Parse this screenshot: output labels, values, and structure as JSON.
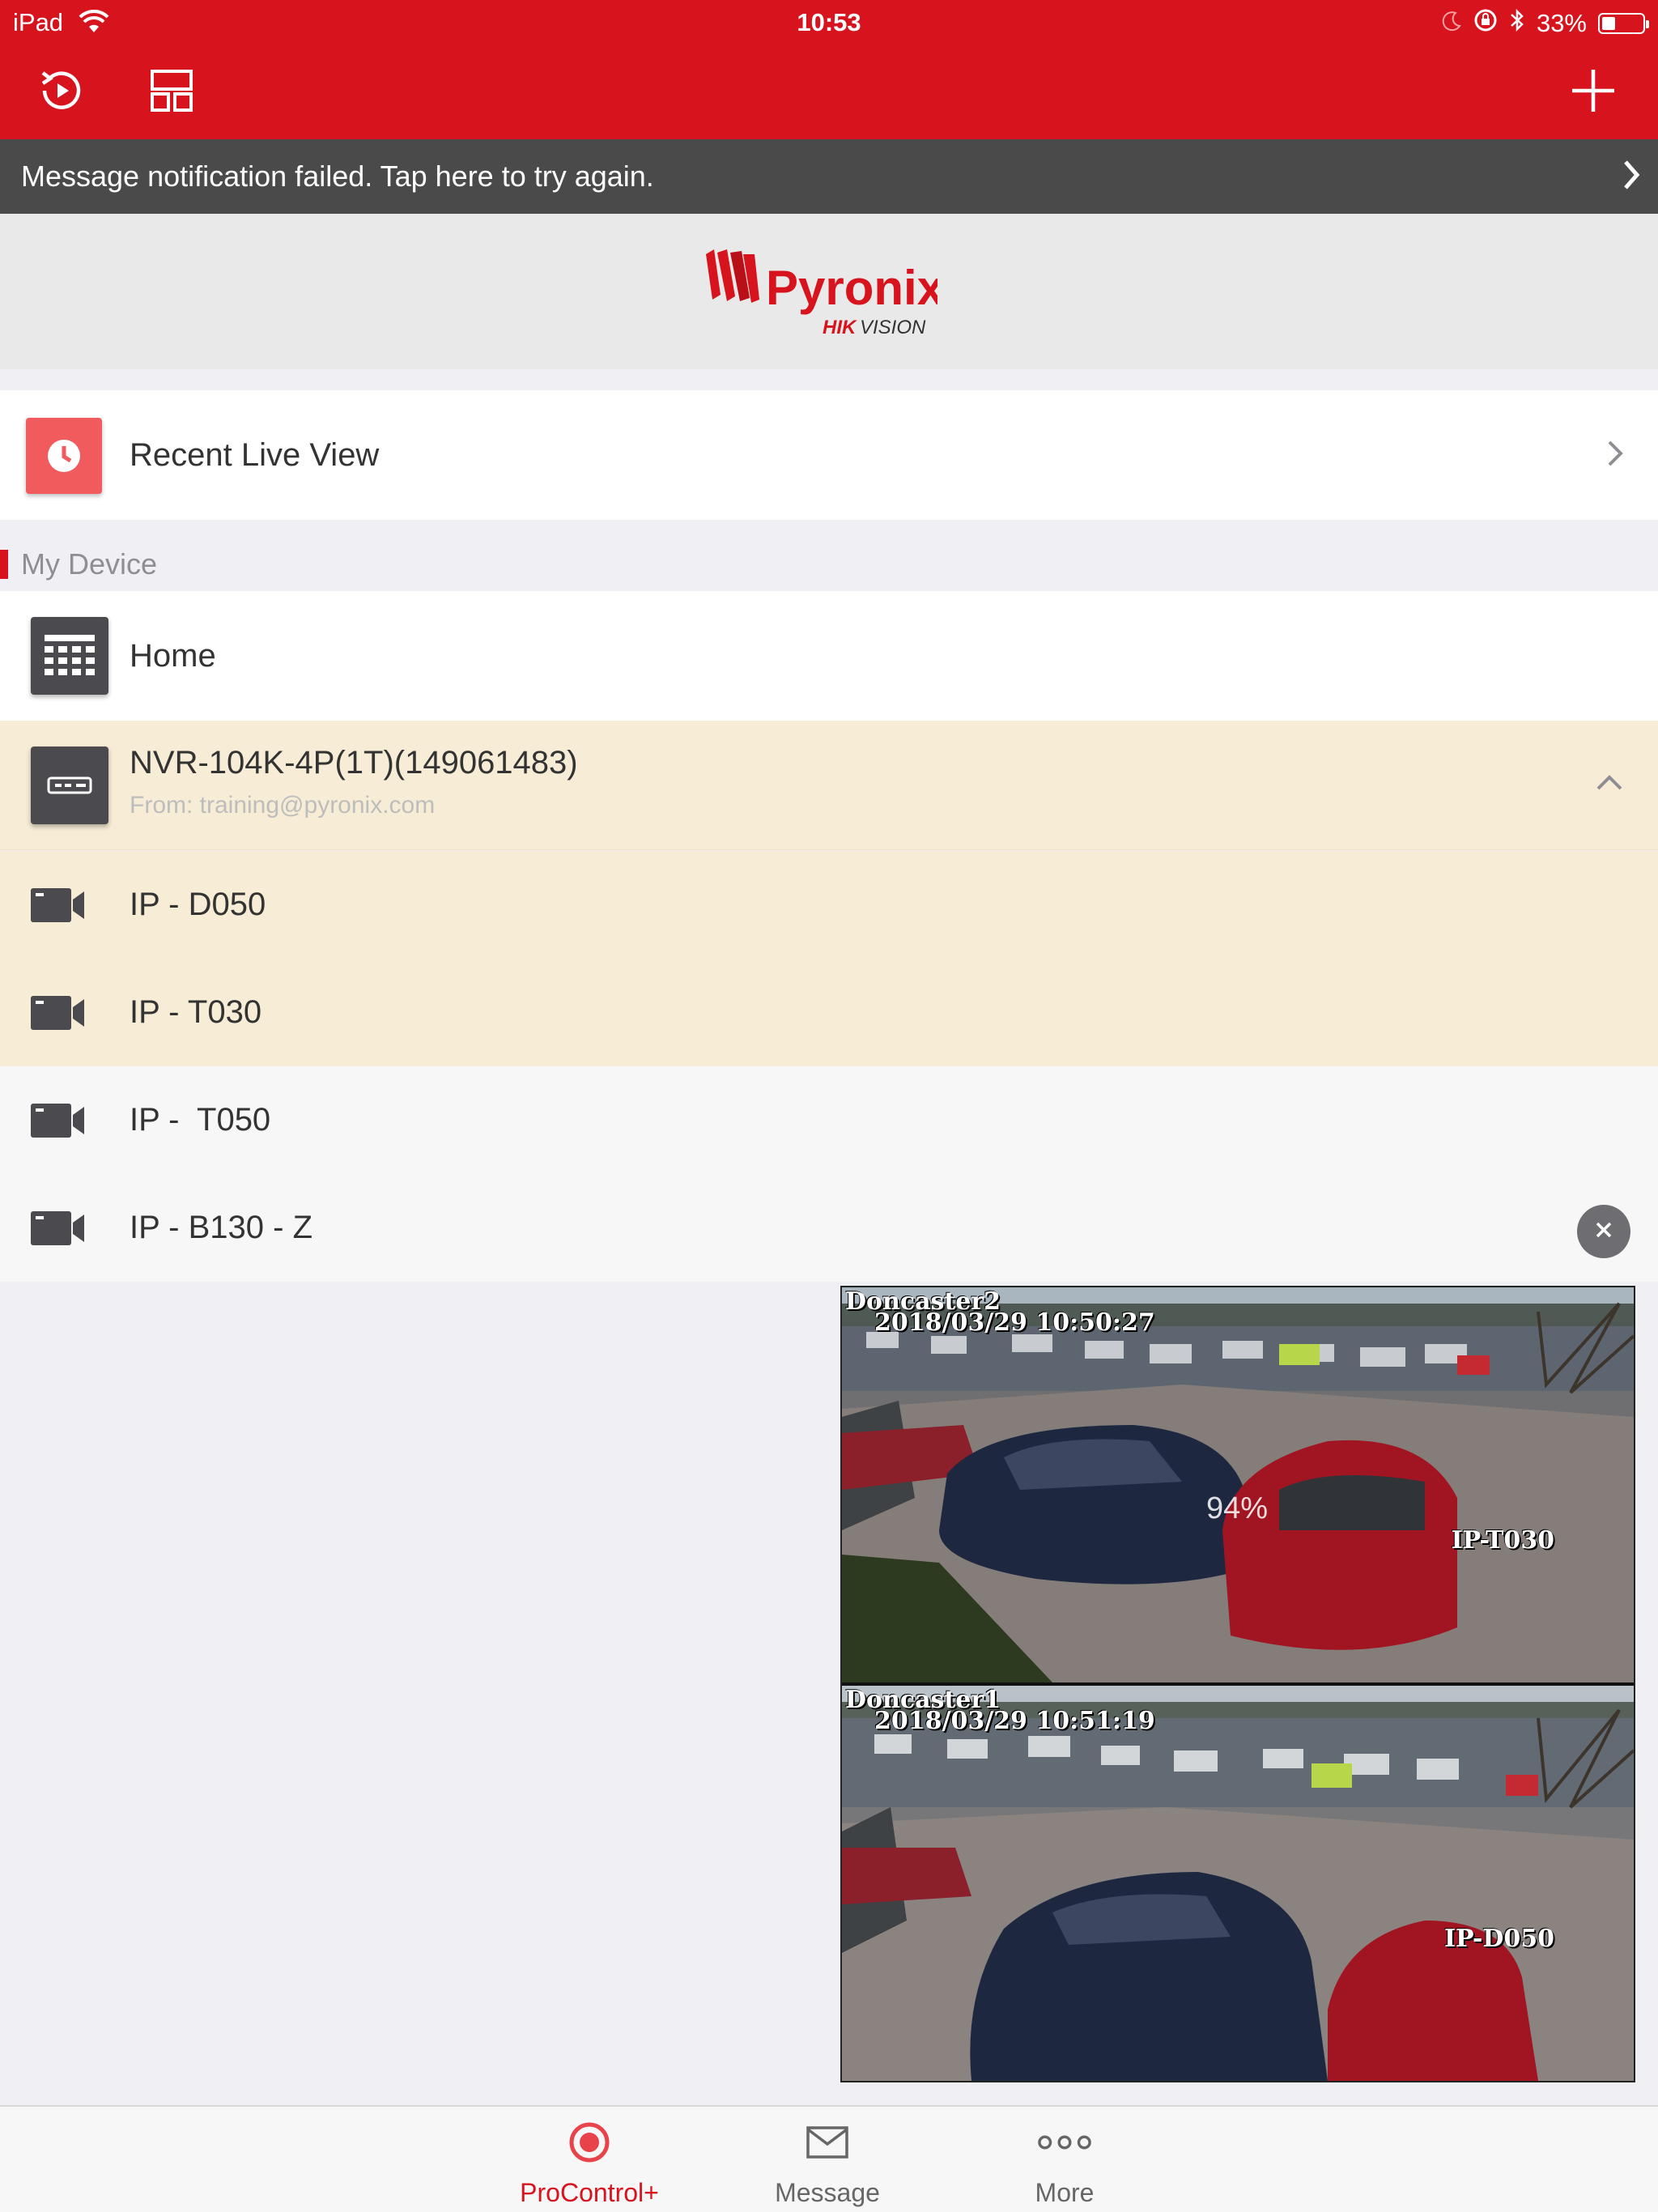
{
  "status_bar": {
    "carrier": "iPad",
    "time": "10:53",
    "battery": "33%",
    "battery_level": 0.33
  },
  "toolbar": {
    "history_label": "playback",
    "layout_label": "layout",
    "add_label": "add"
  },
  "notification": {
    "text": "Message notification failed. Tap here to try again."
  },
  "brand": {
    "name": "Pyronix",
    "sub": "HIKVISION",
    "accent": "#d7141e"
  },
  "recent": {
    "label": "Recent Live View"
  },
  "section": {
    "title": "My Device"
  },
  "devices": {
    "home": {
      "label": "Home"
    },
    "nvr": {
      "label": "NVR-104K-4P(1T)(149061483)",
      "from": "From: training@pyronix.com"
    }
  },
  "cameras": [
    {
      "label": "IP - D050"
    },
    {
      "label": "IP - T030"
    },
    {
      "label": "IP -  T050"
    },
    {
      "label": "IP - B130 - Z"
    }
  ],
  "live_view": {
    "feeds": [
      {
        "name": "Doncaster2",
        "timestamp": "2018/03/29 10:50:27",
        "camera": "IP-T030",
        "loading": "94%"
      },
      {
        "name": "Doncaster1",
        "timestamp": "2018/03/29 10:51:19",
        "camera": "IP-D050"
      }
    ]
  },
  "tabs": [
    {
      "label": "ProControl+",
      "icon": "procontrol-icon",
      "active": true
    },
    {
      "label": "Message",
      "icon": "envelope-icon",
      "active": false
    },
    {
      "label": "More",
      "icon": "more-dots-icon",
      "active": false
    }
  ]
}
